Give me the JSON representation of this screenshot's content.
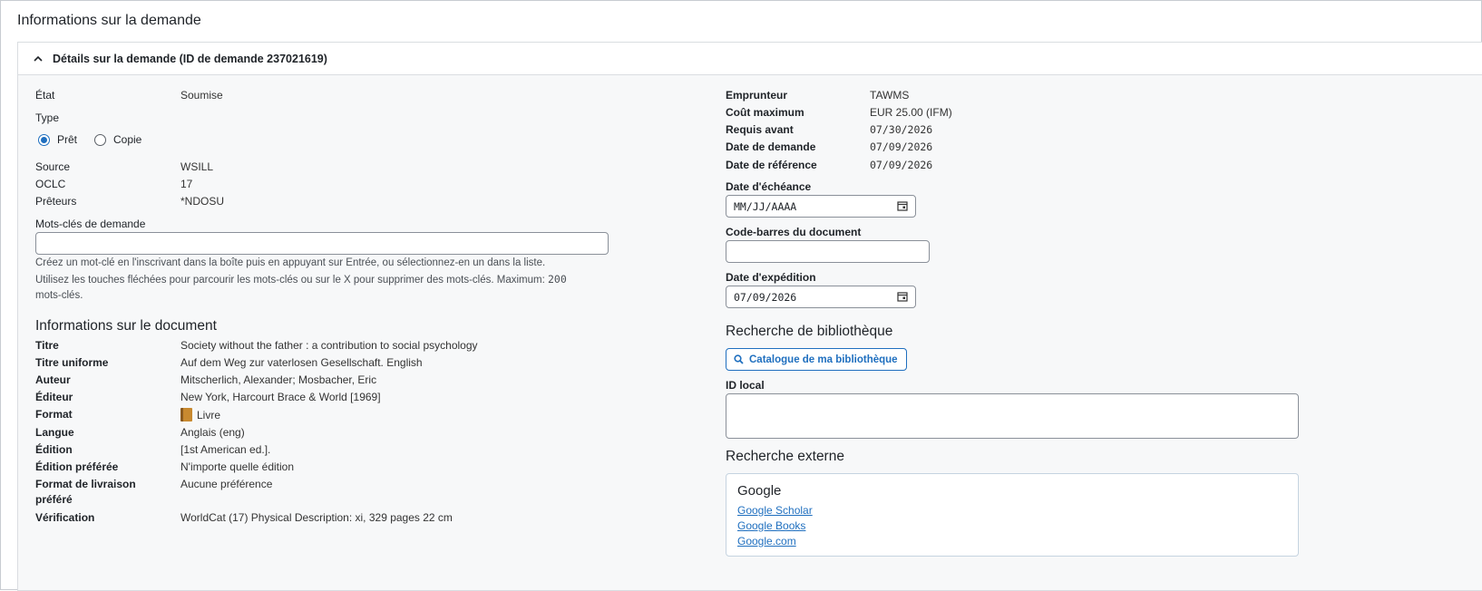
{
  "page_title": "Informations sur la demande",
  "panel": {
    "title": "Détails sur la demande (ID de demande 237021619)"
  },
  "left": {
    "etat": {
      "label": "État",
      "value": "Soumise"
    },
    "type": {
      "label": "Type",
      "options": [
        {
          "label": "Prêt",
          "selected": true
        },
        {
          "label": "Copie",
          "selected": false
        }
      ]
    },
    "source": {
      "label": "Source",
      "value": "WSILL"
    },
    "oclc": {
      "label": "OCLC",
      "value": "17"
    },
    "preteurs": {
      "label": "Prêteurs",
      "value": "*NDOSU"
    },
    "keywords": {
      "label": "Mots-clés de demande",
      "value": "",
      "help_line1": "Créez un mot-clé en l'inscrivant dans la boîte puis en appuyant sur Entrée, ou sélectionnez-en un dans la liste.",
      "help_line2a": "Utilisez les touches fléchées pour parcourir les mots-clés ou sur le X pour supprimer des mots-clés. Maximum: ",
      "help_max": "200",
      "help_line3": "mots-clés."
    },
    "doc_section_title": "Informations sur le document",
    "doc": {
      "titre": {
        "label": "Titre",
        "value": "Society without the father : a contribution to social psychology"
      },
      "titre_uniforme": {
        "label": "Titre uniforme",
        "value": "Auf dem Weg zur vaterlosen Gesellschaft. English"
      },
      "auteur": {
        "label": "Auteur",
        "value": "Mitscherlich, Alexander; Mosbacher, Eric"
      },
      "editeur": {
        "label": "Éditeur",
        "value": "New York, Harcourt Brace & World [1969]"
      },
      "format": {
        "label": "Format",
        "value": "Livre",
        "icon": "book-icon"
      },
      "langue": {
        "label": "Langue",
        "value": "Anglais (eng)"
      },
      "edition": {
        "label": "Édition",
        "value": "[1st American ed.]."
      },
      "edition_preferee": {
        "label": "Édition préférée",
        "value": "N'importe quelle édition"
      },
      "format_livraison": {
        "label_line1": "Format de livraison",
        "label_line2": "préféré",
        "value": "Aucune préférence"
      },
      "verification": {
        "label": "Vérification",
        "value": "WorldCat (17) Physical Description: xi, 329 pages 22 cm"
      }
    }
  },
  "right": {
    "emprunteur": {
      "label": "Emprunteur",
      "value": "TAWMS"
    },
    "cout_max": {
      "label": "Coût maximum",
      "value_amount": "EUR 25.00",
      "value_unit": " (IFM)"
    },
    "requis_avant": {
      "label": "Requis avant",
      "value": "07/30/2026"
    },
    "date_demande": {
      "label": "Date de demande",
      "value": "07/09/2026"
    },
    "date_reference": {
      "label": "Date de référence",
      "value": "07/09/2026"
    },
    "date_echeance": {
      "label": "Date d'échéance",
      "placeholder": "MM/JJ/AAAA"
    },
    "code_barres": {
      "label": "Code-barres du document",
      "value": ""
    },
    "date_expedition": {
      "label": "Date d'expédition",
      "value": "07/09/2026"
    },
    "recherche_bib_title": "Recherche de bibliothèque",
    "catalogue_button": "Catalogue de ma bibliothèque",
    "id_local": {
      "label": "ID local",
      "value": ""
    },
    "recherche_ext_title": "Recherche externe",
    "google": {
      "title": "Google",
      "links": [
        "Google Scholar",
        "Google Books",
        "Google.com"
      ]
    }
  },
  "colors": {
    "accent": "#1f6fbf",
    "border": "#dadde1",
    "panel_bg": "#f7f8f9"
  }
}
